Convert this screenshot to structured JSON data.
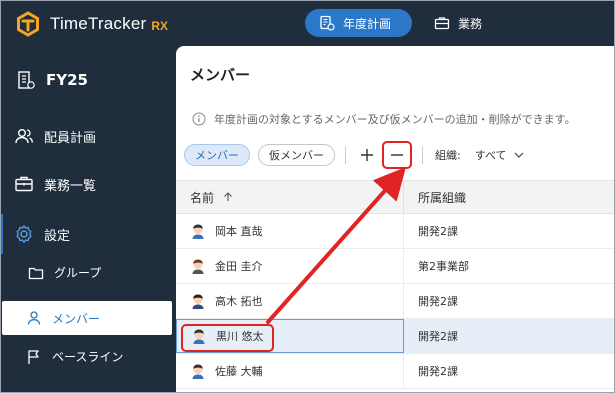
{
  "app": {
    "logo_text": "TimeTracker",
    "logo_suffix": "RX"
  },
  "topnav": {
    "tabs": [
      {
        "label": "年度計画",
        "icon": "annual-plan-icon",
        "active": true
      },
      {
        "label": "業務",
        "icon": "briefcase-icon",
        "active": false
      }
    ]
  },
  "sidebar": {
    "fiscal_year": "FY25",
    "items": [
      {
        "label": "配員計画",
        "icon": "people-icon"
      },
      {
        "label": "業務一覧",
        "icon": "briefcase-icon"
      },
      {
        "label": "設定",
        "icon": "gear-icon"
      },
      {
        "label": "グループ",
        "icon": "folder-icon"
      },
      {
        "label": "メンバー",
        "icon": "person-icon"
      },
      {
        "label": "ベースライン",
        "icon": "flag-icon"
      }
    ]
  },
  "main": {
    "title": "メンバー",
    "description": "年度計画の対象とするメンバー及び仮メンバーの追加・削除ができます。",
    "toolbar": {
      "chip_member": "メンバー",
      "chip_temp": "仮メンバー",
      "org_label": "組織:",
      "org_value": "すべて"
    },
    "table": {
      "headers": {
        "name": "名前",
        "org": "所属組織"
      },
      "rows": [
        {
          "name": "岡本 直哉",
          "org": "開発2課"
        },
        {
          "name": "金田 圭介",
          "org": "第2事業部"
        },
        {
          "name": "高木 拓也",
          "org": "開発2課"
        },
        {
          "name": "黒川 悠太",
          "org": "開発2課"
        },
        {
          "name": "佐藤 大輔",
          "org": "開発2課"
        }
      ]
    }
  },
  "colors": {
    "accent": "#2b78c8",
    "highlight": "#e02424",
    "sidebar_bg": "#1f2d3d"
  }
}
